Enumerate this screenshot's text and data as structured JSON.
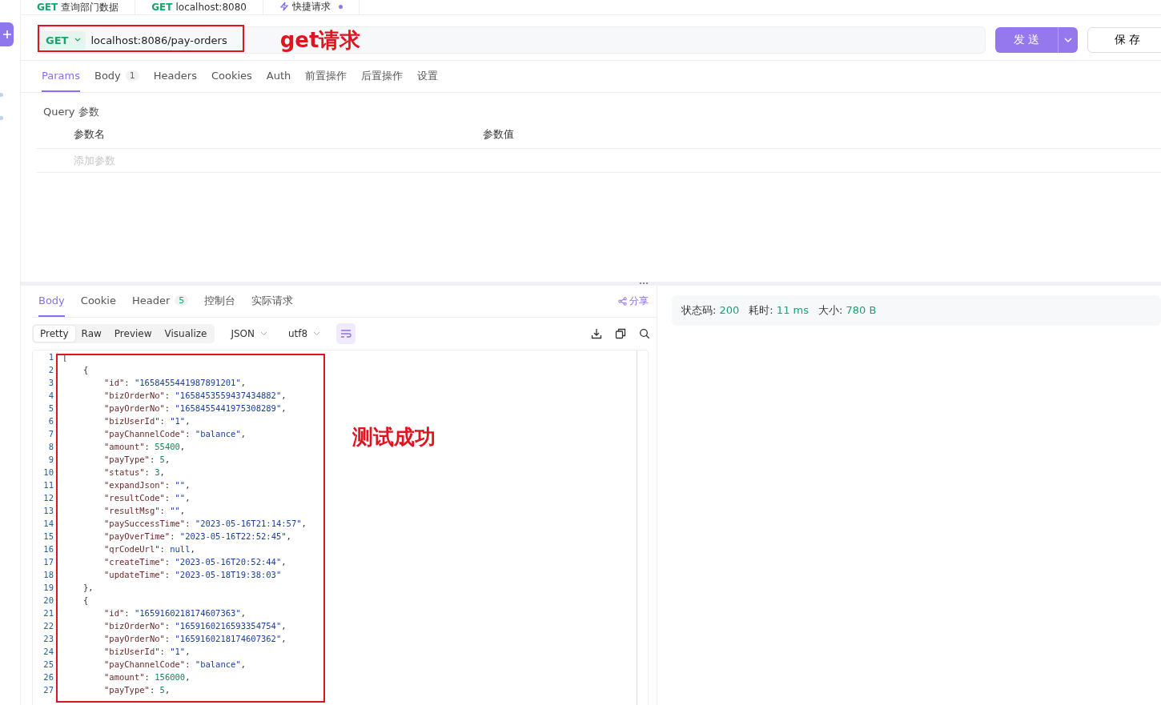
{
  "request_tabs": [
    {
      "method": "GET",
      "label": "查询部门数据",
      "selected": false
    },
    {
      "method": "GET",
      "label": "localhost:8080",
      "selected": false
    },
    {
      "label": "快捷请求",
      "selected": true
    }
  ],
  "request": {
    "method": "GET",
    "url": "localhost:8086/pay-orders",
    "send_label": "发 送",
    "save_label": "保 存"
  },
  "annotations": [
    {
      "kind": "label",
      "text": "get请求"
    },
    {
      "kind": "label",
      "text": "测试成功"
    }
  ],
  "param_tabs": [
    {
      "label": "Params",
      "selected": true
    },
    {
      "label": "Body",
      "selected": false,
      "badge": "1"
    },
    {
      "label": "Headers",
      "selected": false
    },
    {
      "label": "Cookies",
      "selected": false
    },
    {
      "label": "Auth",
      "selected": false
    },
    {
      "label": "前置操作",
      "selected": false
    },
    {
      "label": "后置操作",
      "selected": false
    },
    {
      "label": "设置",
      "selected": false
    }
  ],
  "query": {
    "title": "Query 参数",
    "columns": [
      "参数名",
      "参数值"
    ],
    "placeholder": "添加参数"
  },
  "response_tabs": [
    {
      "label": "Body",
      "selected": true
    },
    {
      "label": "Cookie",
      "selected": false
    },
    {
      "label": "Header",
      "selected": false,
      "badge": "5"
    },
    {
      "label": "控制台",
      "selected": false
    },
    {
      "label": "实际请求",
      "selected": false
    }
  ],
  "share_label": "分享",
  "view_modes": [
    {
      "label": "Pretty",
      "selected": true
    },
    {
      "label": "Raw",
      "selected": false
    },
    {
      "label": "Preview",
      "selected": false
    },
    {
      "label": "Visualize",
      "selected": false
    }
  ],
  "format": "JSON",
  "encoding": "utf8",
  "wrap_on": true,
  "status": [
    {
      "label": "状态码:",
      "value": "200"
    },
    {
      "label": "耗时:",
      "value": "11 ms"
    },
    {
      "label": "大小:",
      "value": "780 B"
    }
  ],
  "code_lines": [
    {
      "ln": "1",
      "kind": "root",
      "parts": [
        {
          "kind": "punct",
          "text": "["
        }
      ]
    },
    {
      "ln": "2",
      "kind": "object",
      "parts": [
        {
          "kind": "punct",
          "text": "{"
        }
      ]
    },
    {
      "ln": "3",
      "kind": "field",
      "parts": [
        {
          "kind": "key",
          "text": "\"id\""
        },
        {
          "kind": "punct",
          "text": ": "
        },
        {
          "kind": "string",
          "text": "\"1658455441987891201\""
        },
        {
          "kind": "punct",
          "text": ","
        }
      ]
    },
    {
      "ln": "4",
      "kind": "field",
      "parts": [
        {
          "kind": "key",
          "text": "\"bizOrderNo\""
        },
        {
          "kind": "punct",
          "text": ": "
        },
        {
          "kind": "string",
          "text": "\"1658453559437434882\""
        },
        {
          "kind": "punct",
          "text": ","
        }
      ]
    },
    {
      "ln": "5",
      "kind": "field",
      "parts": [
        {
          "kind": "key",
          "text": "\"payOrderNo\""
        },
        {
          "kind": "punct",
          "text": ": "
        },
        {
          "kind": "string",
          "text": "\"1658455441975308289\""
        },
        {
          "kind": "punct",
          "text": ","
        }
      ]
    },
    {
      "ln": "6",
      "kind": "field",
      "parts": [
        {
          "kind": "key",
          "text": "\"bizUserId\""
        },
        {
          "kind": "punct",
          "text": ": "
        },
        {
          "kind": "string",
          "text": "\"1\""
        },
        {
          "kind": "punct",
          "text": ","
        }
      ]
    },
    {
      "ln": "7",
      "kind": "field",
      "parts": [
        {
          "kind": "key",
          "text": "\"payChannelCode\""
        },
        {
          "kind": "punct",
          "text": ": "
        },
        {
          "kind": "string",
          "text": "\"balance\""
        },
        {
          "kind": "punct",
          "text": ","
        }
      ]
    },
    {
      "ln": "8",
      "kind": "field",
      "parts": [
        {
          "kind": "key",
          "text": "\"amount\""
        },
        {
          "kind": "punct",
          "text": ": "
        },
        {
          "kind": "number",
          "text": "55400"
        },
        {
          "kind": "punct",
          "text": ","
        }
      ]
    },
    {
      "ln": "9",
      "kind": "field",
      "parts": [
        {
          "kind": "key",
          "text": "\"payType\""
        },
        {
          "kind": "punct",
          "text": ": "
        },
        {
          "kind": "number",
          "text": "5"
        },
        {
          "kind": "punct",
          "text": ","
        }
      ]
    },
    {
      "ln": "10",
      "kind": "field",
      "parts": [
        {
          "kind": "key",
          "text": "\"status\""
        },
        {
          "kind": "punct",
          "text": ": "
        },
        {
          "kind": "number",
          "text": "3"
        },
        {
          "kind": "punct",
          "text": ","
        }
      ]
    },
    {
      "ln": "11",
      "kind": "field",
      "parts": [
        {
          "kind": "key",
          "text": "\"expandJson\""
        },
        {
          "kind": "punct",
          "text": ": "
        },
        {
          "kind": "string",
          "text": "\"\""
        },
        {
          "kind": "punct",
          "text": ","
        }
      ]
    },
    {
      "ln": "12",
      "kind": "field",
      "parts": [
        {
          "kind": "key",
          "text": "\"resultCode\""
        },
        {
          "kind": "punct",
          "text": ": "
        },
        {
          "kind": "string",
          "text": "\"\""
        },
        {
          "kind": "punct",
          "text": ","
        }
      ]
    },
    {
      "ln": "13",
      "kind": "field",
      "parts": [
        {
          "kind": "key",
          "text": "\"resultMsg\""
        },
        {
          "kind": "punct",
          "text": ": "
        },
        {
          "kind": "string",
          "text": "\"\""
        },
        {
          "kind": "punct",
          "text": ","
        }
      ]
    },
    {
      "ln": "14",
      "kind": "field",
      "parts": [
        {
          "kind": "key",
          "text": "\"paySuccessTime\""
        },
        {
          "kind": "punct",
          "text": ": "
        },
        {
          "kind": "string",
          "text": "\"2023-05-16T21:14:57\""
        },
        {
          "kind": "punct",
          "text": ","
        }
      ]
    },
    {
      "ln": "15",
      "kind": "field",
      "parts": [
        {
          "kind": "key",
          "text": "\"payOverTime\""
        },
        {
          "kind": "punct",
          "text": ": "
        },
        {
          "kind": "string",
          "text": "\"2023-05-16T22:52:45\""
        },
        {
          "kind": "punct",
          "text": ","
        }
      ]
    },
    {
      "ln": "16",
      "kind": "field",
      "parts": [
        {
          "kind": "key",
          "text": "\"qrCodeUrl\""
        },
        {
          "kind": "punct",
          "text": ": "
        },
        {
          "kind": "string",
          "text": "null"
        },
        {
          "kind": "punct",
          "text": ","
        }
      ]
    },
    {
      "ln": "17",
      "kind": "field",
      "parts": [
        {
          "kind": "key",
          "text": "\"createTime\""
        },
        {
          "kind": "punct",
          "text": ": "
        },
        {
          "kind": "string",
          "text": "\"2023-05-16T20:52:44\""
        },
        {
          "kind": "punct",
          "text": ","
        }
      ]
    },
    {
      "ln": "18",
      "kind": "field",
      "parts": [
        {
          "kind": "key",
          "text": "\"updateTime\""
        },
        {
          "kind": "punct",
          "text": ": "
        },
        {
          "kind": "string",
          "text": "\"2023-05-18T19:38:03\""
        }
      ]
    },
    {
      "ln": "19",
      "kind": "object",
      "parts": [
        {
          "kind": "punct",
          "text": "},"
        }
      ]
    },
    {
      "ln": "20",
      "kind": "object",
      "parts": [
        {
          "kind": "punct",
          "text": "{"
        }
      ]
    },
    {
      "ln": "21",
      "kind": "field",
      "parts": [
        {
          "kind": "key",
          "text": "\"id\""
        },
        {
          "kind": "punct",
          "text": ": "
        },
        {
          "kind": "string",
          "text": "\"1659160218174607363\""
        },
        {
          "kind": "punct",
          "text": ","
        }
      ]
    },
    {
      "ln": "22",
      "kind": "field",
      "parts": [
        {
          "kind": "key",
          "text": "\"bizOrderNo\""
        },
        {
          "kind": "punct",
          "text": ": "
        },
        {
          "kind": "string",
          "text": "\"1659160216593354754\""
        },
        {
          "kind": "punct",
          "text": ","
        }
      ]
    },
    {
      "ln": "23",
      "kind": "field",
      "parts": [
        {
          "kind": "key",
          "text": "\"payOrderNo\""
        },
        {
          "kind": "punct",
          "text": ": "
        },
        {
          "kind": "string",
          "text": "\"1659160218174607362\""
        },
        {
          "kind": "punct",
          "text": ","
        }
      ]
    },
    {
      "ln": "24",
      "kind": "field",
      "parts": [
        {
          "kind": "key",
          "text": "\"bizUserId\""
        },
        {
          "kind": "punct",
          "text": ": "
        },
        {
          "kind": "string",
          "text": "\"1\""
        },
        {
          "kind": "punct",
          "text": ","
        }
      ]
    },
    {
      "ln": "25",
      "kind": "field",
      "parts": [
        {
          "kind": "key",
          "text": "\"payChannelCode\""
        },
        {
          "kind": "punct",
          "text": ": "
        },
        {
          "kind": "string",
          "text": "\"balance\""
        },
        {
          "kind": "punct",
          "text": ","
        }
      ]
    },
    {
      "ln": "26",
      "kind": "field",
      "parts": [
        {
          "kind": "key",
          "text": "\"amount\""
        },
        {
          "kind": "punct",
          "text": ": "
        },
        {
          "kind": "number",
          "text": "156000"
        },
        {
          "kind": "punct",
          "text": ","
        }
      ]
    },
    {
      "ln": "27",
      "kind": "field",
      "parts": [
        {
          "kind": "key",
          "text": "\"payType\""
        },
        {
          "kind": "punct",
          "text": ": "
        },
        {
          "kind": "number",
          "text": "5"
        },
        {
          "kind": "punct",
          "text": ","
        }
      ]
    }
  ]
}
